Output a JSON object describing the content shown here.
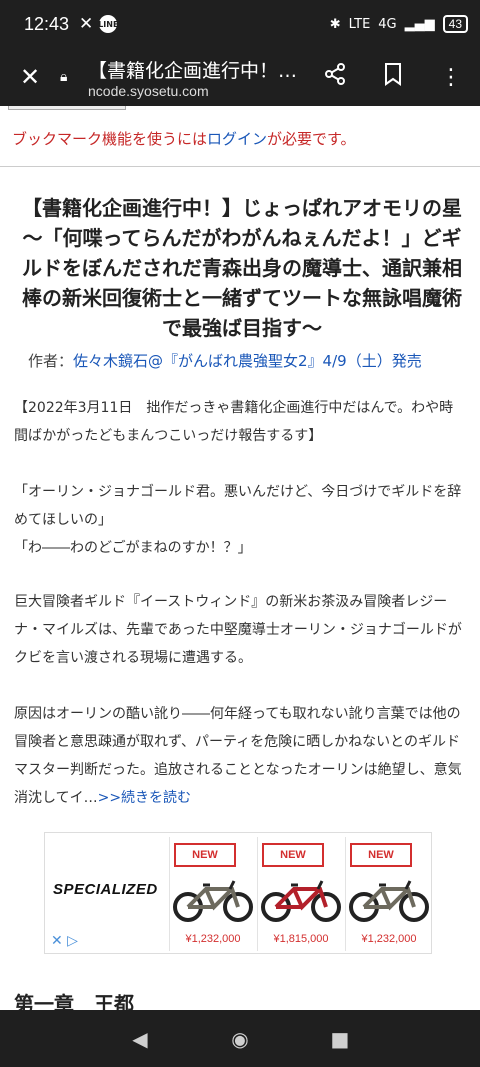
{
  "status": {
    "time": "12:43",
    "line_badge": "LINE",
    "signal": "4G",
    "lte": "LTE",
    "battery": "43"
  },
  "toolbar": {
    "title": "【書籍化企画進行中！…",
    "url": "ncode.syosetu.com"
  },
  "notice": {
    "prefix": "ブックマーク機能を使うには",
    "login": "ログイン",
    "suffix": "が必要です。"
  },
  "novel": {
    "title": "【書籍化企画進行中！】じょっぱれアオモリの星　～「何喋ってらんだがわがんねぇんだよ！」どギルドをぼんだされだ青森出身の魔導士、通訳兼相棒の新米回復術士と一緒ずてツートな無詠唱魔術で最強ば目指す～",
    "author_label": "作者：",
    "author": "佐々木鏡石@『がんばれ農強聖女2』4/9（土）発売"
  },
  "synopsis": {
    "p1": "【2022年3月11日　拙作だっきゃ書籍化企画進行中だはんで。わや時間ばかがったどもまんつこいっだけ報告するす】",
    "p2a": "「オーリン・ジョナゴールド君。悪いんだけど、今日づけでギルドを辞めてほしいの」",
    "p2b": "「わ――わのどごがまねのすか！？」",
    "p3": "巨大冒険者ギルド『イーストウィンド』の新米お茶汲み冒険者レジーナ・マイルズは、先輩であった中堅魔導士オーリン・ジョナゴールドがクビを言い渡される現場に遭遇する。",
    "p4": "原因はオーリンの酷い訛り――何年経っても取れない訛り言葉では他の冒険者と意思疎通が取れず、パーティを危険に晒しかねないとのギルドマスター判断だった。追放されることとなったオーリンは絶望し、意気消沈してイ…",
    "more": ">>続きを読む"
  },
  "ad": {
    "brand": "SPECIALIZED",
    "products": [
      {
        "badge": "NEW",
        "price": "¥1,232,000",
        "color": "#6d6a5e"
      },
      {
        "badge": "NEW",
        "price": "¥1,815,000",
        "color": "#b3202a"
      },
      {
        "badge": "NEW",
        "price": "¥1,232,000",
        "color": "#6d6a5e"
      }
    ]
  },
  "chapter": {
    "title": "第一章　王都"
  },
  "nav": {
    "back": "◀",
    "home": "◉",
    "recents": "■"
  }
}
